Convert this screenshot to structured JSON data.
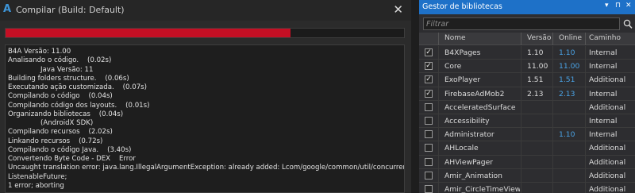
{
  "compile_dialog": {
    "app_icon": "A",
    "title": "Compilar (Build: Default)",
    "close_label": "✕",
    "progress": 0.715,
    "progress_color": "#c40f24",
    "log_lines": [
      "B4A Versão: 11.00",
      "Analisando o código.    (0.02s)",
      "               Java Versão: 11",
      "Building folders structure.    (0.06s)",
      "Executando ação customizada.    (0.07s)",
      "Compilando o código    (0.04s)",
      "Compilando código dos layouts.    (0.01s)",
      "Organizando bibliotecas    (0.04s)",
      "               (AndroidX SDK)",
      "Compilando recursos    (2.02s)",
      "Linkando recursos    (0.72s)",
      "Compilando o código Java.    (3.40s)",
      "Convertendo Byte Code - DEX    Error",
      "Uncaught translation error: java.lang.IllegalArgumentException: already added: Lcom/google/common/util/concurrent/",
      "ListenableFuture;",
      "1 error; aborting"
    ]
  },
  "library_manager": {
    "title": "Gestor de bibliotecas",
    "titlebar_buttons": [
      "▾",
      "⊓",
      "✕"
    ],
    "filter_placeholder": "Filtrar",
    "search_icon": "search-icon",
    "accent_color": "#1e71c8",
    "columns": [
      "Nome",
      "Versão",
      "Online",
      "Caminho"
    ],
    "rows": [
      {
        "checked": true,
        "name": "B4XPages",
        "version": "1.10",
        "online": "1.10",
        "path": "Internal"
      },
      {
        "checked": true,
        "name": "Core",
        "version": "11.00",
        "online": "11.00",
        "path": "Internal"
      },
      {
        "checked": true,
        "name": "ExoPlayer",
        "version": "1.51",
        "online": "1.51",
        "path": "Additional"
      },
      {
        "checked": true,
        "name": "FirebaseAdMob2",
        "version": "2.13",
        "online": "2.13",
        "path": "Internal"
      },
      {
        "checked": false,
        "name": "AcceleratedSurface",
        "version": "",
        "online": "",
        "path": "Additional"
      },
      {
        "checked": false,
        "name": "Accessibility",
        "version": "",
        "online": "",
        "path": "Internal"
      },
      {
        "checked": false,
        "name": "Administrator",
        "version": "",
        "online": "1.10",
        "path": "Internal"
      },
      {
        "checked": false,
        "name": "AHLocale",
        "version": "",
        "online": "",
        "path": "Additional"
      },
      {
        "checked": false,
        "name": "AHViewPager",
        "version": "",
        "online": "",
        "path": "Additional"
      },
      {
        "checked": false,
        "name": "Amir_Animation",
        "version": "",
        "online": "",
        "path": "Additional"
      },
      {
        "checked": false,
        "name": "Amir_CircleTimeView",
        "version": "",
        "online": "",
        "path": "Additional"
      }
    ]
  }
}
